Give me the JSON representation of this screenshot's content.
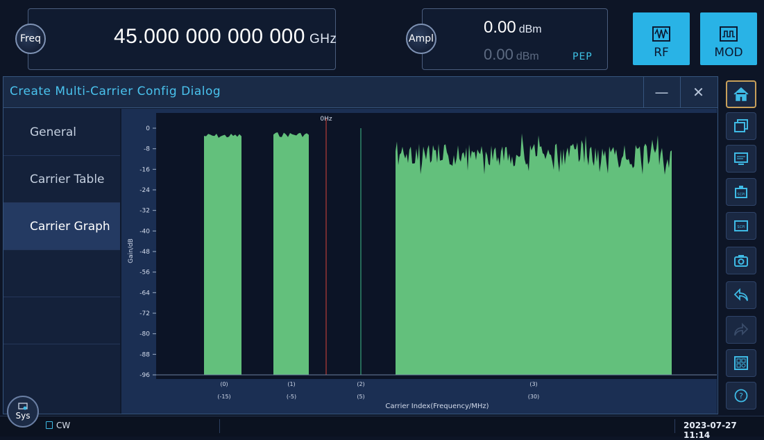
{
  "freq": {
    "knob_label": "Freq",
    "value": "45.000 000 000 000",
    "unit": "GHz"
  },
  "ampl": {
    "knob_label": "Ampl",
    "value": "0.00",
    "unit": "dBm",
    "pep_value": "0.00",
    "pep_unit": "dBm",
    "pep_label": "PEP"
  },
  "mode_buttons": {
    "rf": "RF",
    "mod": "MOD"
  },
  "dialog": {
    "title": "Create Multi-Carrier Config Dialog",
    "minimize": "—",
    "close": "✕",
    "nav": [
      "General",
      "Carrier Table",
      "Carrier Graph"
    ],
    "active_nav": "Carrier Graph"
  },
  "chart_data": {
    "type": "area",
    "ylabel": "Gain/dB",
    "xlabel": "Carrier Index(Frequency/MHz)",
    "ylim": [
      -96,
      0
    ],
    "yticks": [
      "0",
      "-8",
      "-16",
      "-24",
      "-32",
      "-40",
      "-48",
      "-56",
      "-64",
      "-72",
      "-80",
      "-88",
      "-96"
    ],
    "center_label": "0Hz",
    "carriers": [
      {
        "index": "(0)",
        "freq": "(-15)"
      },
      {
        "index": "(1)",
        "freq": "(-5)"
      },
      {
        "index": "(2)",
        "freq": "(5)"
      },
      {
        "index": "(3)",
        "freq": "(30)"
      }
    ],
    "carrier_levels_db": [
      -2,
      -1.5,
      -96,
      -6
    ],
    "colors": {
      "fill": "#63c07c",
      "center_line": "#d8433a",
      "narrow_carrier": "#3fbf8a",
      "plot_bg": "#0c1426"
    }
  },
  "status": {
    "mode": "CW",
    "datetime": "2023-07-27 11:14",
    "sys_label": "Sys"
  },
  "right_icons": [
    "home-icon",
    "windows-icon",
    "display-icon",
    "scpi-record-icon",
    "scpi-icon",
    "camera-icon",
    "back-icon",
    "forward-icon",
    "layout-icon",
    "help-icon"
  ]
}
